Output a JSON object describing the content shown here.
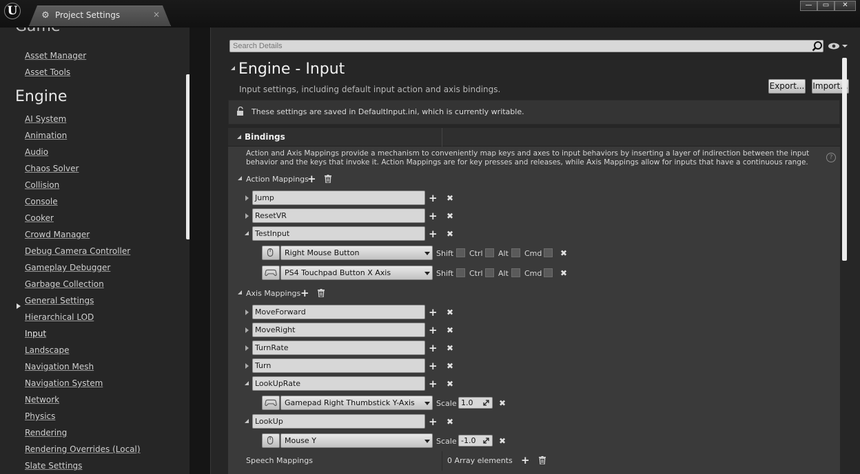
{
  "window": {
    "tab_title": "Project Settings",
    "tab_close": "×",
    "controls": [
      "—",
      "▭",
      "✕"
    ]
  },
  "sidebar": {
    "clipped_section": "Game",
    "game_items": [
      "Asset Manager",
      "Asset Tools"
    ],
    "engine_section": "Engine",
    "engine_items": [
      "AI System",
      "Animation",
      "Audio",
      "Chaos Solver",
      "Collision",
      "Console",
      "Cooker",
      "Crowd Manager",
      "Debug Camera Controller",
      "Gameplay Debugger",
      "Garbage Collection",
      "General Settings",
      "Hierarchical LOD",
      "Input",
      "Landscape",
      "Navigation Mesh",
      "Navigation System",
      "Network",
      "Physics",
      "Rendering",
      "Rendering Overrides (Local)",
      "Slate Settings"
    ],
    "active_item": "Input"
  },
  "search": {
    "placeholder": "Search Details"
  },
  "header": {
    "title": "Engine - Input",
    "description": "Input settings, including default input action and axis bindings.",
    "export_label": "Export...",
    "import_label": "Import..."
  },
  "notice": {
    "text": "These settings are saved in DefaultInput.ini, which is currently writable."
  },
  "bindings": {
    "title": "Bindings",
    "description": "Action and Axis Mappings provide a mechanism to conveniently map keys and axes to input behaviors by inserting a layer of indirection between the input behavior and the keys that invoke it. Action Mappings are for key presses and releases, while Axis Mappings allow for inputs that have a continuous range.",
    "help": "?",
    "action_mappings_label": "Action Mappings",
    "action_mappings": [
      {
        "name": "Jump",
        "expanded": false
      },
      {
        "name": "ResetVR",
        "expanded": false
      },
      {
        "name": "TestInput",
        "expanded": true
      }
    ],
    "action_keys": [
      {
        "device": "mouse-icon",
        "key": "Right Mouse Button"
      },
      {
        "device": "gamepad-icon",
        "key": "PS4 Touchpad Button X Axis"
      }
    ],
    "modifiers": [
      "Shift",
      "Ctrl",
      "Alt",
      "Cmd"
    ],
    "axis_mappings_label": "Axis Mappings",
    "axis_mappings": [
      {
        "name": "MoveForward",
        "expanded": false
      },
      {
        "name": "MoveRight",
        "expanded": false
      },
      {
        "name": "TurnRate",
        "expanded": false
      },
      {
        "name": "Turn",
        "expanded": false
      },
      {
        "name": "LookUpRate",
        "expanded": true
      },
      {
        "name": "LookUp",
        "expanded": true
      }
    ],
    "axis_keys": [
      {
        "device": "gamepad-icon",
        "key": "Gamepad Right Thumbstick Y-Axis",
        "scale": "1.0"
      },
      {
        "device": "mouse-icon",
        "key": "Mouse Y",
        "scale": "-1.0"
      }
    ],
    "scale_label": "Scale",
    "speech_mappings_label": "Speech Mappings",
    "speech_mappings_value": "0 Array elements"
  }
}
